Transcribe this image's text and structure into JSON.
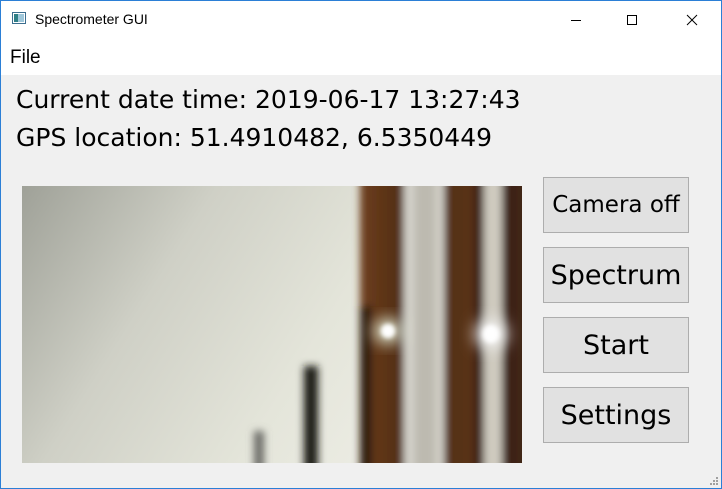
{
  "window": {
    "title": "Spectrometer GUI",
    "controls": {
      "minimize_icon": "minimize-icon",
      "maximize_icon": "maximize-icon",
      "close_icon": "close-icon"
    }
  },
  "menu": {
    "items": [
      {
        "label": "File"
      }
    ]
  },
  "info": {
    "datetime": "Current date time: 2019-06-17 13:27:43",
    "gps": "GPS location: 51.4910482, 6.5350449"
  },
  "camera": {
    "feed_icon": "camera-feed-image"
  },
  "buttons": {
    "camera_off": "Camera off",
    "spectrum": "Spectrum",
    "start": "Start",
    "settings": "Settings"
  },
  "colors": {
    "window_border": "#2b7fd6",
    "window_bg": "#f0f0f0",
    "button_bg": "#e1e1e1",
    "button_border": "#adadad"
  }
}
